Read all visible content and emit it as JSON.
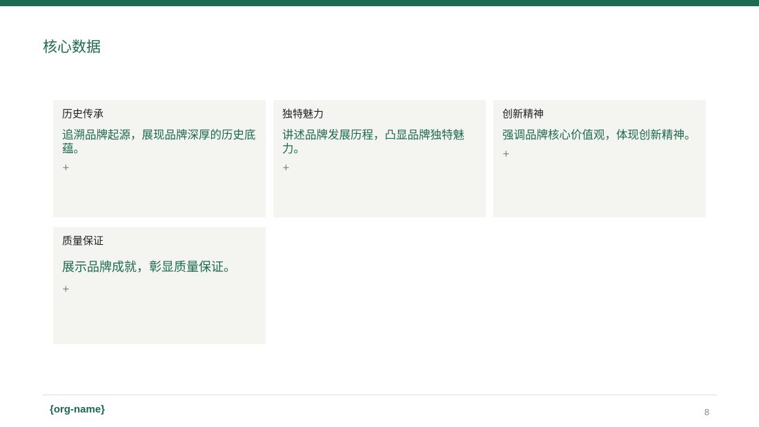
{
  "slide": {
    "title": "核心数据",
    "accent_color": "#1c6a4f",
    "card_background": "#f4f4f1"
  },
  "cards": [
    {
      "title": "历史传承",
      "description": "追溯品牌起源，展现品牌深厚的历史底蕴。",
      "plus": "+"
    },
    {
      "title": "独特魅力",
      "description": "讲述品牌发展历程，凸显品牌独特魅力。",
      "plus": "+"
    },
    {
      "title": "创新精神",
      "description": "强调品牌核心价值观，体现创新精神。",
      "plus": "+"
    },
    {
      "title": "质量保证",
      "description": "展示品牌成就，彰显质量保证。",
      "plus": "+"
    }
  ],
  "footer": {
    "org_name": "{org-name}",
    "page_number": "8"
  }
}
